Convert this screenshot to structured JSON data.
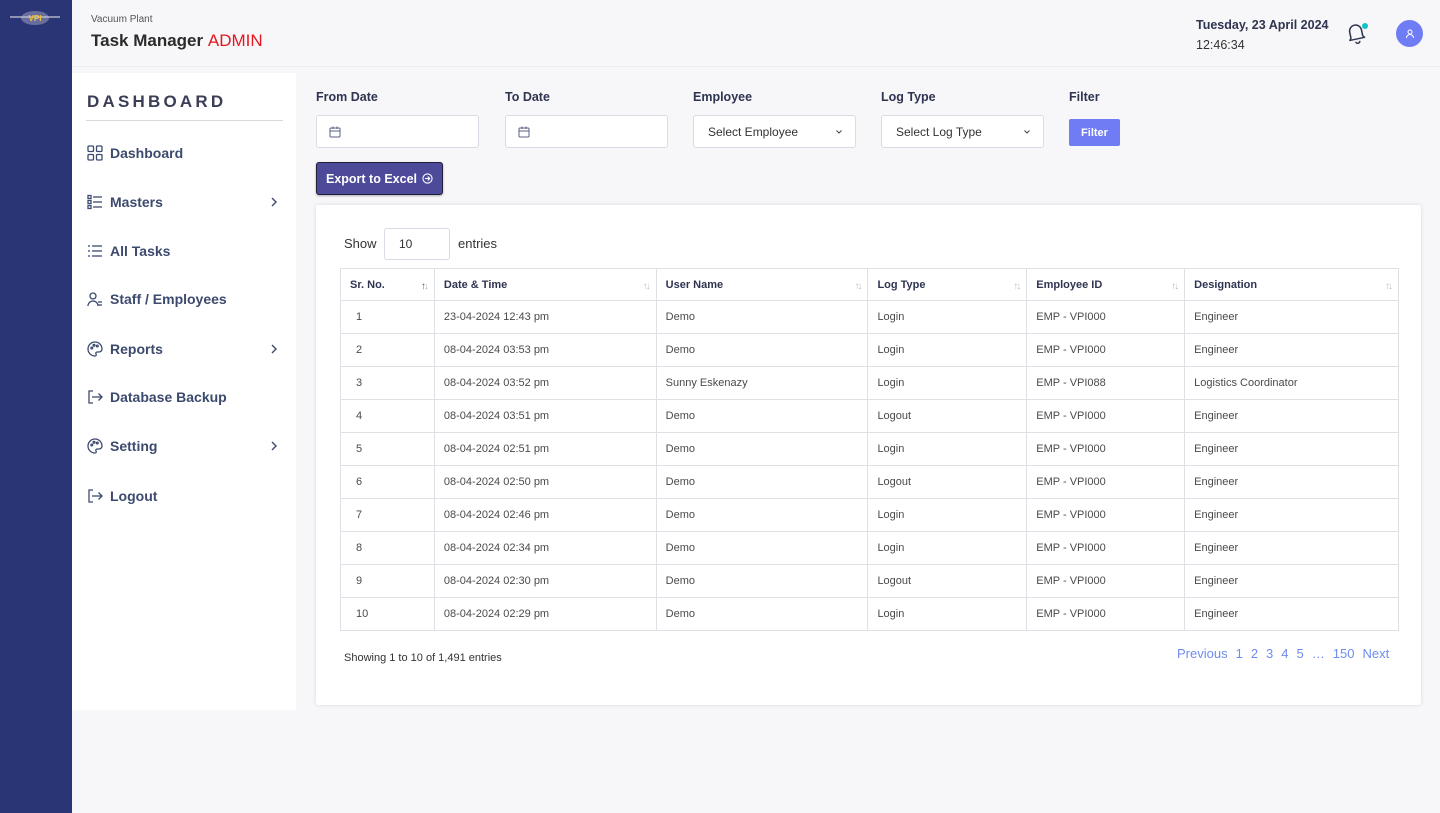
{
  "header": {
    "subtitle": "Vacuum Plant",
    "title": "Task Manager",
    "title_suffix": "ADMIN",
    "date": "Tuesday, 23 April 2024",
    "time": "12:46:34"
  },
  "sidebar": {
    "heading": "DASHBOARD",
    "items": [
      {
        "label": "Dashboard",
        "icon": "grid-icon"
      },
      {
        "label": "Masters",
        "icon": "list-icon"
      },
      {
        "label": "All Tasks",
        "icon": "lines-icon"
      },
      {
        "label": "Staff / Employees",
        "icon": "user-icon"
      },
      {
        "label": "Reports",
        "icon": "palette-icon"
      },
      {
        "label": "Database Backup",
        "icon": "logout-arrow-icon"
      },
      {
        "label": "Setting",
        "icon": "palette-icon"
      },
      {
        "label": "Logout",
        "icon": "logout-arrow-icon"
      }
    ]
  },
  "filters": {
    "from_date_label": "From Date",
    "to_date_label": "To Date",
    "employee_label": "Employee",
    "employee_value": "Select Employee",
    "log_type_label": "Log Type",
    "log_type_value": "Select Log Type",
    "filter_label": "Filter",
    "filter_button": "Filter",
    "export_button": "Export to Excel"
  },
  "table": {
    "show_label": "Show",
    "entries_value": "10",
    "entries_label": "entries",
    "columns": [
      "Sr. No.",
      "Date & Time",
      "User Name",
      "Log Type",
      "Employee ID",
      "Designation"
    ],
    "rows": [
      [
        "1",
        "23-04-2024 12:43 pm",
        "Demo",
        "Login",
        "EMP - VPI000",
        "Engineer"
      ],
      [
        "2",
        "08-04-2024 03:53 pm",
        "Demo",
        "Login",
        "EMP - VPI000",
        "Engineer"
      ],
      [
        "3",
        "08-04-2024 03:52 pm",
        "Sunny Eskenazy",
        "Login",
        "EMP - VPI088",
        "Logistics Coordinator"
      ],
      [
        "4",
        "08-04-2024 03:51 pm",
        "Demo",
        "Logout",
        "EMP - VPI000",
        "Engineer"
      ],
      [
        "5",
        "08-04-2024 02:51 pm",
        "Demo",
        "Login",
        "EMP - VPI000",
        "Engineer"
      ],
      [
        "6",
        "08-04-2024 02:50 pm",
        "Demo",
        "Logout",
        "EMP - VPI000",
        "Engineer"
      ],
      [
        "7",
        "08-04-2024 02:46 pm",
        "Demo",
        "Login",
        "EMP - VPI000",
        "Engineer"
      ],
      [
        "8",
        "08-04-2024 02:34 pm",
        "Demo",
        "Login",
        "EMP - VPI000",
        "Engineer"
      ],
      [
        "9",
        "08-04-2024 02:30 pm",
        "Demo",
        "Logout",
        "EMP - VPI000",
        "Engineer"
      ],
      [
        "10",
        "08-04-2024 02:29 pm",
        "Demo",
        "Login",
        "EMP - VPI000",
        "Engineer"
      ]
    ],
    "info": "Showing 1 to 10 of 1,491 entries",
    "pagination": [
      "Previous",
      "1",
      "2",
      "3",
      "4",
      "5",
      "…",
      "150",
      "Next"
    ]
  },
  "colors": {
    "strip": "#2a3576",
    "accent": "#6f7cf4",
    "export": "#4d4a9a",
    "admin": "#e5161f",
    "notification_dot": "#12c2c4"
  }
}
